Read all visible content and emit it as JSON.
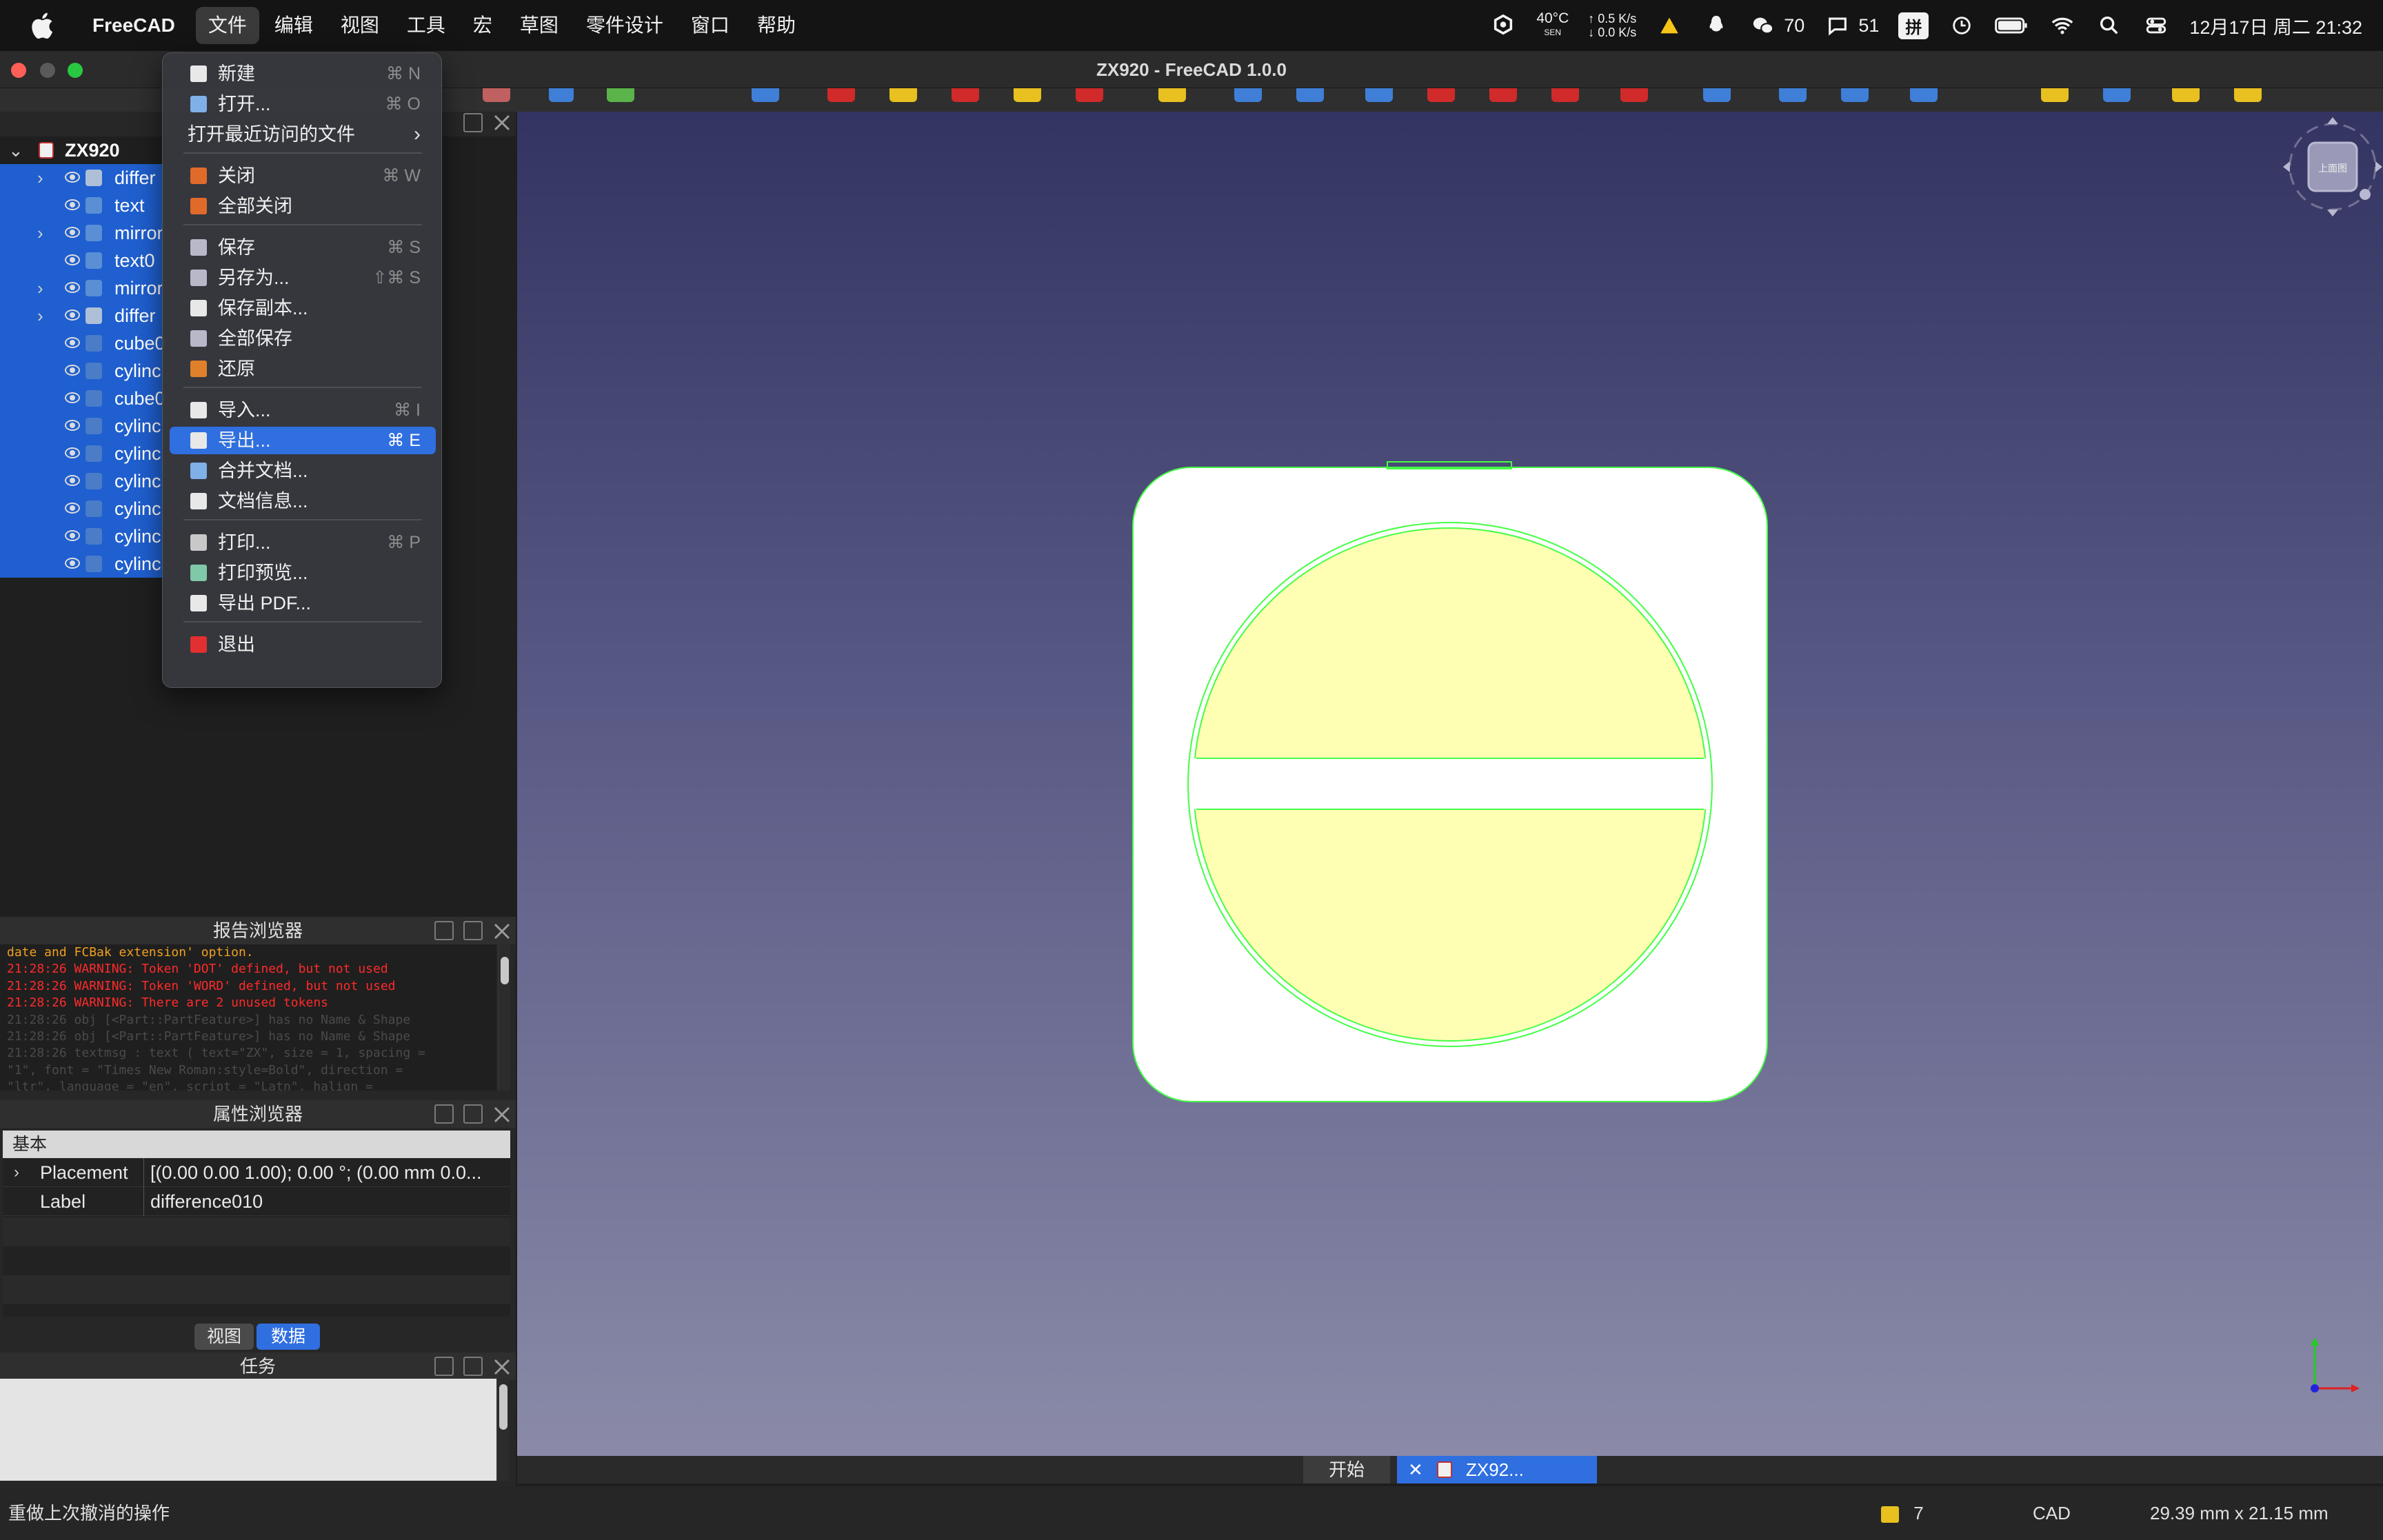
{
  "menubar": {
    "app_name": "FreeCAD",
    "items": [
      "文件",
      "编辑",
      "视图",
      "工具",
      "宏",
      "草图",
      "零件设计",
      "窗口",
      "帮助"
    ],
    "status": {
      "temp": "40°C",
      "temp_sub": "SEN",
      "net_up": "↑ 0.5 K/s",
      "net_down": "↓ 0.0 K/s",
      "wechat_count": "70",
      "chat_count": "51",
      "ime": "拼",
      "datetime": "12月17日 周二 21:32"
    }
  },
  "window": {
    "title": "ZX920 - FreeCAD 1.0.0"
  },
  "tree": {
    "root": "ZX920",
    "items": [
      {
        "label": "differ",
        "expand": true,
        "icon_color": "#aebfd8"
      },
      {
        "label": "text",
        "expand": false,
        "icon_color": "#5a8fd6"
      },
      {
        "label": "mirror",
        "expand": true,
        "icon_color": "#5a8fd6"
      },
      {
        "label": "text0",
        "expand": false,
        "icon_color": "#5a8fd6"
      },
      {
        "label": "mirror",
        "expand": true,
        "icon_color": "#5a8fd6"
      },
      {
        "label": "differ",
        "expand": true,
        "icon_color": "#aebfd8"
      },
      {
        "label": "cube0",
        "expand": false,
        "icon_color": "#4a7cc8"
      },
      {
        "label": "cylinc",
        "expand": false,
        "icon_color": "#4a7cc8"
      },
      {
        "label": "cube0",
        "expand": false,
        "icon_color": "#4a7cc8"
      },
      {
        "label": "cylinc",
        "expand": false,
        "icon_color": "#4a7cc8"
      },
      {
        "label": "cylinc",
        "expand": false,
        "icon_color": "#4a7cc8"
      },
      {
        "label": "cylinc",
        "expand": false,
        "icon_color": "#4a7cc8"
      },
      {
        "label": "cylinc",
        "expand": false,
        "icon_color": "#4a7cc8"
      },
      {
        "label": "cylinc",
        "expand": false,
        "icon_color": "#4a7cc8"
      },
      {
        "label": "cylinc",
        "expand": false,
        "icon_color": "#4a7cc8"
      }
    ]
  },
  "report": {
    "title": "报告浏览器",
    "lines": [
      {
        "text": "date and FCBak extension' option.",
        "color": "#f0a020"
      },
      {
        "text": "21:28:26  WARNING: Token 'DOT' defined, but not used",
        "color": "#ff2a2a"
      },
      {
        "text": "21:28:26  WARNING: Token 'WORD' defined, but not used",
        "color": "#ff2a2a"
      },
      {
        "text": "21:28:26  WARNING: There are 2 unused tokens",
        "color": "#ff2a2a"
      },
      {
        "text": "21:28:26  obj [<Part::PartFeature>] has no Name & Shape",
        "color": "#4a4a4a"
      },
      {
        "text": "21:28:26  obj [<Part::PartFeature>] has no Name & Shape",
        "color": "#4a4a4a"
      },
      {
        "text": "21:28:26  textmsg : text ( text=\"ZX\", size = 1, spacing =",
        "color": "#4a4a4a"
      },
      {
        "text": "\"1\", font = \"Times New Roman:style=Bold\", direction =",
        "color": "#4a4a4a"
      },
      {
        "text": "\"ltr\", language = \"en\", script = \"Latn\", halign =",
        "color": "#4a4a4a"
      }
    ]
  },
  "properties": {
    "title": "属性浏览器",
    "group": "基本",
    "rows": [
      {
        "key": "Placement",
        "value": "[(0.00 0.00 1.00); 0.00 °; (0.00 mm  0.0...",
        "expand": true
      },
      {
        "key": "Label",
        "value": "difference010",
        "expand": false
      }
    ],
    "tabs": [
      "视图",
      "数据"
    ],
    "active_tab": "数据"
  },
  "tasks": {
    "title": "任务"
  },
  "file_menu": {
    "items": [
      {
        "label": "新建",
        "shortcut": "⌘ N",
        "icon_color": "#e8e8e8"
      },
      {
        "label": "打开...",
        "shortcut": "⌘ O",
        "icon_color": "#7fb0e8"
      },
      {
        "label": "打开最近访问的文件",
        "shortcut": "",
        "icon_color": ""
      },
      {
        "label": "关闭",
        "shortcut": "⌘ W",
        "icon_color": "#e06a2a"
      },
      {
        "label": "全部关闭",
        "shortcut": "",
        "icon_color": "#e06a2a"
      },
      {
        "label": "保存",
        "shortcut": "⌘ S",
        "icon_color": "#b8b8c8"
      },
      {
        "label": "另存为...",
        "shortcut": "⇧⌘ S",
        "icon_color": "#b8b8c8"
      },
      {
        "label": "保存副本...",
        "shortcut": "",
        "icon_color": "#e8e8e8"
      },
      {
        "label": "全部保存",
        "shortcut": "",
        "icon_color": "#b8b8c8"
      },
      {
        "label": "还原",
        "shortcut": "",
        "icon_color": "#e0802a"
      },
      {
        "label": "导入...",
        "shortcut": "⌘ I",
        "icon_color": "#e8e8e8"
      },
      {
        "label": "导出...",
        "shortcut": "⌘ E",
        "icon_color": "#e8e8e8"
      },
      {
        "label": "合并文档...",
        "shortcut": "",
        "icon_color": "#7fb0e8"
      },
      {
        "label": "文档信息...",
        "shortcut": "",
        "icon_color": "#e8e8e8"
      },
      {
        "label": "打印...",
        "shortcut": "⌘ P",
        "icon_color": "#c8c8c8"
      },
      {
        "label": "打印预览...",
        "shortcut": "",
        "icon_color": "#7fc8a8"
      },
      {
        "label": "导出 PDF...",
        "shortcut": "",
        "icon_color": "#e8e8e8"
      },
      {
        "label": "退出",
        "shortcut": "",
        "icon_color": "#e03030"
      }
    ],
    "selected": "导出..."
  },
  "viewport": {
    "navcube_face": "上面图",
    "face_color": "#ffffb4",
    "edge_color": "#44ff44"
  },
  "doc_tabs": [
    "开始",
    "ZX92..."
  ],
  "statusbar": {
    "message": "重做上次撤消的操作",
    "count": "7",
    "nav_style": "CAD",
    "dimensions": "29.39 mm x 21.15 mm"
  }
}
